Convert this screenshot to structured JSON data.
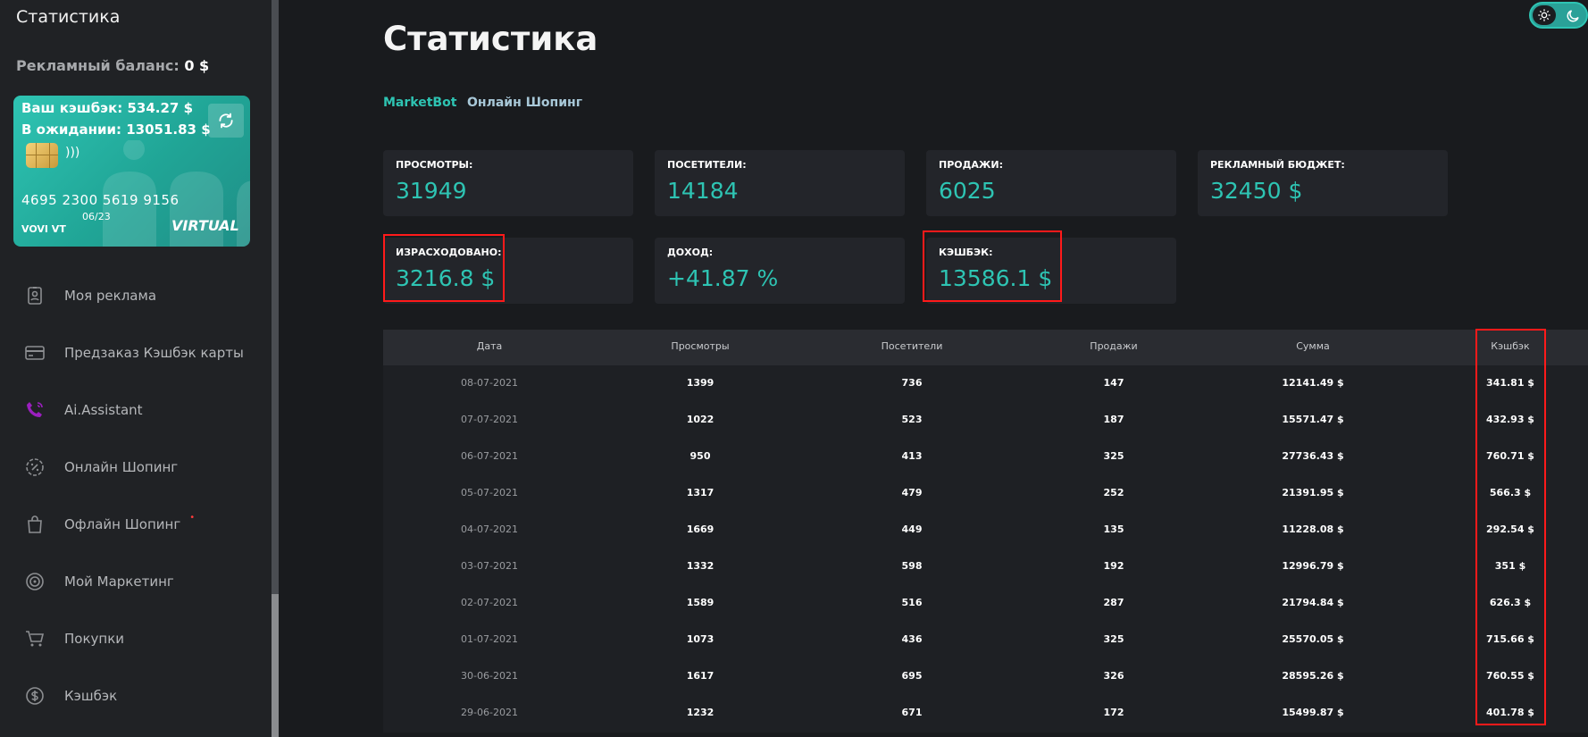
{
  "sidebar": {
    "title": "Статистика",
    "balance_label": "Рекламный баланс:",
    "balance_value": "0 $",
    "card": {
      "cashback_line": "Ваш кэшбэк: 534.27 $",
      "pending_line": "В ожидании: 13051.83 $",
      "number": "4695 2300 5619 9156",
      "expiry": "06/23",
      "holder": "VOVI VT",
      "brand": "VIRTUAL"
    },
    "items": [
      {
        "label": "Моя реклама",
        "icon": "id-badge-icon"
      },
      {
        "label": "Предзаказ Кэшбэк карты",
        "icon": "credit-card-icon"
      },
      {
        "label": "Ai.Assistant",
        "icon": "phone-call-icon"
      },
      {
        "label": "Онлайн Шопинг",
        "icon": "percent-badge-icon"
      },
      {
        "label": "Офлайн Шопинг",
        "icon": "shopping-bag-icon"
      },
      {
        "label": "Мой Маркетинг",
        "icon": "target-icon"
      },
      {
        "label": "Покупки",
        "icon": "cart-icon"
      },
      {
        "label": "Кэшбэк",
        "icon": "dollar-circle-icon"
      }
    ],
    "offline_badge": "•"
  },
  "main": {
    "title": "Статистика",
    "tabs": [
      {
        "label": "MarketBot",
        "active": true
      },
      {
        "label": "Онлайн Шопинг",
        "active": false
      }
    ],
    "stats": [
      {
        "label": "ПРОСМОТРЫ:",
        "value": "31949"
      },
      {
        "label": "ПОСЕТИТЕЛИ:",
        "value": "14184"
      },
      {
        "label": "ПРОДАЖИ:",
        "value": "6025"
      },
      {
        "label": "РЕКЛАМНЫЙ БЮДЖЕТ:",
        "value": "32450 $"
      },
      {
        "label": "ИЗРАСХОДОВАНО:",
        "value": "3216.8 $"
      },
      {
        "label": "ДОХОД:",
        "value": "+41.87 %"
      },
      {
        "label": "КЭШБЭК:",
        "value": "13586.1 $"
      }
    ],
    "table": {
      "headers": [
        "Дата",
        "Просмотры",
        "Посетители",
        "Продажи",
        "Сумма",
        "Кэшбэк"
      ],
      "rows": [
        [
          "08-07-2021",
          "1399",
          "736",
          "147",
          "12141.49 $",
          "341.81 $"
        ],
        [
          "07-07-2021",
          "1022",
          "523",
          "187",
          "15571.47 $",
          "432.93 $"
        ],
        [
          "06-07-2021",
          "950",
          "413",
          "325",
          "27736.43 $",
          "760.71 $"
        ],
        [
          "05-07-2021",
          "1317",
          "479",
          "252",
          "21391.95 $",
          "566.3 $"
        ],
        [
          "04-07-2021",
          "1669",
          "449",
          "135",
          "11228.08 $",
          "292.54 $"
        ],
        [
          "03-07-2021",
          "1332",
          "598",
          "192",
          "12996.79 $",
          "351 $"
        ],
        [
          "02-07-2021",
          "1589",
          "516",
          "287",
          "21794.84 $",
          "626.3 $"
        ],
        [
          "01-07-2021",
          "1073",
          "436",
          "325",
          "25570.05 $",
          "715.66 $"
        ],
        [
          "30-06-2021",
          "1617",
          "695",
          "326",
          "28595.26 $",
          "760.55 $"
        ],
        [
          "29-06-2021",
          "1232",
          "671",
          "172",
          "15499.87 $",
          "401.78 $"
        ]
      ]
    }
  },
  "colors": {
    "accent": "#2ec4b3",
    "highlight": "#ff1a1a",
    "background": "#191b1e"
  }
}
